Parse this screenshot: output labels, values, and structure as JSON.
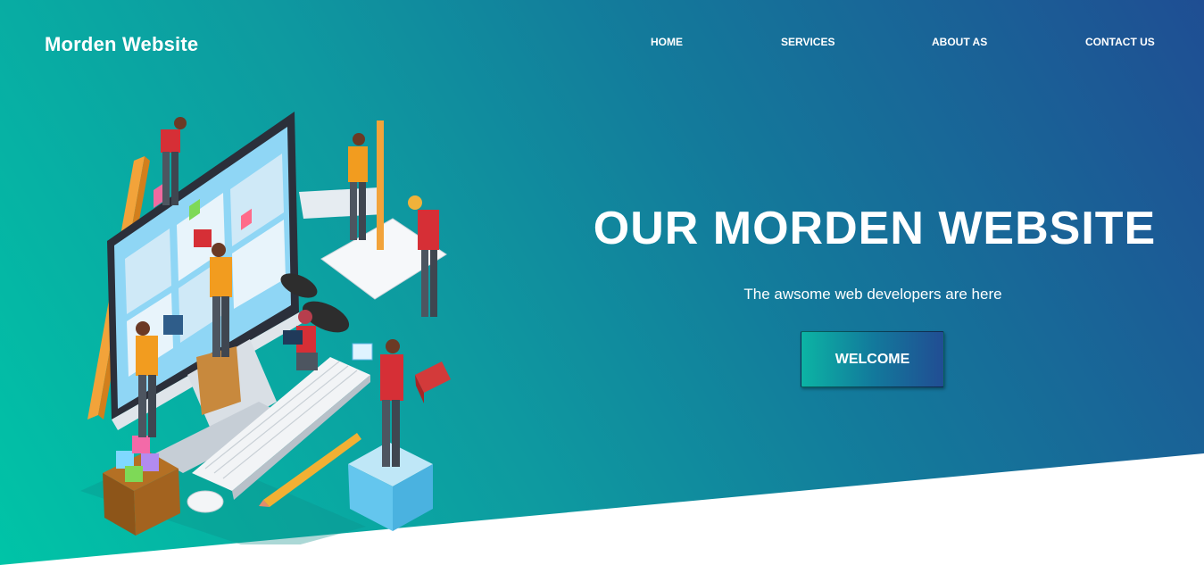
{
  "header": {
    "logo": "Morden Website",
    "nav": [
      "HOME",
      "SERVICES",
      "ABOUT AS",
      "CONTACT US"
    ]
  },
  "hero": {
    "title": "OUR MORDEN WEBSITE",
    "subtitle": "The awsome web developers are here",
    "button_label": "WELCOME",
    "illustration_icon": "isometric-web-developers-illustration"
  },
  "colors": {
    "gradient_start": "#00c4a7",
    "gradient_end": "#1f4e93",
    "text": "#ffffff",
    "background": "#ffffff"
  }
}
